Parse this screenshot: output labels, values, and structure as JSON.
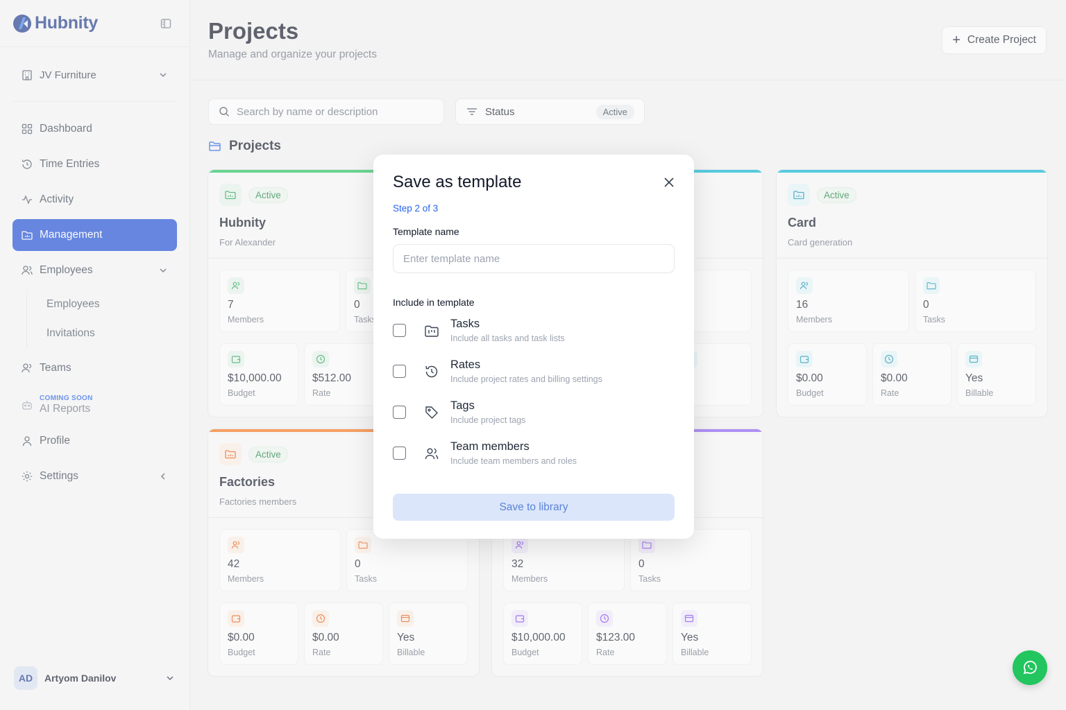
{
  "app": {
    "name": "Hubnity"
  },
  "sidebar": {
    "org": "JV Furniture",
    "items": [
      {
        "label": "Dashboard"
      },
      {
        "label": "Time Entries"
      },
      {
        "label": "Activity"
      },
      {
        "label": "Management"
      },
      {
        "label": "Employees"
      },
      {
        "label": "Teams"
      },
      {
        "label": "Profile"
      },
      {
        "label": "Settings"
      }
    ],
    "employees_sub": [
      "Employees",
      "Invitations"
    ],
    "coming_soon_tag": "COMING SOON",
    "ai_reports": "AI Reports",
    "user": {
      "initials": "AD",
      "name": "Artyom Danilov"
    }
  },
  "header": {
    "title": "Projects",
    "subtitle": "Manage and organize your projects",
    "create_label": "Create Project"
  },
  "toolbar": {
    "search_placeholder": "Search by name or description",
    "status_label": "Status",
    "status_value": "Active"
  },
  "section_title": "Projects",
  "cards": [
    {
      "status": "Active",
      "name": "Hubnity",
      "description": "For Alexander",
      "accent": "#22c55e",
      "members": "7",
      "members_label": "Members",
      "tasks": "0",
      "tasks_label": "Tasks",
      "budget": "$10,000.00",
      "budget_label": "Budget",
      "rate": "$512.00",
      "rate_label": "Rate"
    },
    {
      "status": "Active",
      "name": "Card",
      "description": "Card generation",
      "accent": "#06b6d4",
      "members": "16",
      "members_label": "Members",
      "tasks": "0",
      "tasks_label": "Tasks",
      "budget": "$0.00",
      "budget_label": "Budget",
      "rate": "$0.00",
      "rate_label": "Rate",
      "billable": "Yes",
      "billable_label": "Billable"
    },
    {
      "status": "Active",
      "name": "Factories",
      "description": "Factories members",
      "accent": "#f97316",
      "members": "42",
      "members_label": "Members",
      "tasks": "0",
      "tasks_label": "Tasks",
      "budget": "$0.00",
      "budget_label": "Budget",
      "rate": "$0.00",
      "rate_label": "Rate",
      "billable": "Yes",
      "billable_label": "Billable"
    },
    {
      "accent": "#8b5cf6",
      "members": "32",
      "members_label": "Members",
      "tasks": "0",
      "tasks_label": "Tasks",
      "budget": "$10,000.00",
      "budget_label": "Budget",
      "rate": "$123.00",
      "rate_label": "Rate",
      "billable": "Yes",
      "billable_label": "Billable"
    }
  ],
  "hidden_card_fragments": {
    "billable_partial": "ble",
    "yes_partial": "s"
  },
  "modal": {
    "title": "Save as template",
    "step": "Step 2 of 3",
    "name_label": "Template name",
    "name_placeholder": "Enter template name",
    "include_label": "Include in template",
    "options": [
      {
        "title": "Tasks",
        "desc": "Include all tasks and task lists"
      },
      {
        "title": "Rates",
        "desc": "Include project rates and billing settings"
      },
      {
        "title": "Tags",
        "desc": "Include project tags"
      },
      {
        "title": "Team members",
        "desc": "Include team members and roles"
      }
    ],
    "save_label": "Save to library"
  },
  "colors": {
    "primary": "#1d4ed8",
    "active_green": "#15803d",
    "whatsapp": "#22c55e"
  }
}
